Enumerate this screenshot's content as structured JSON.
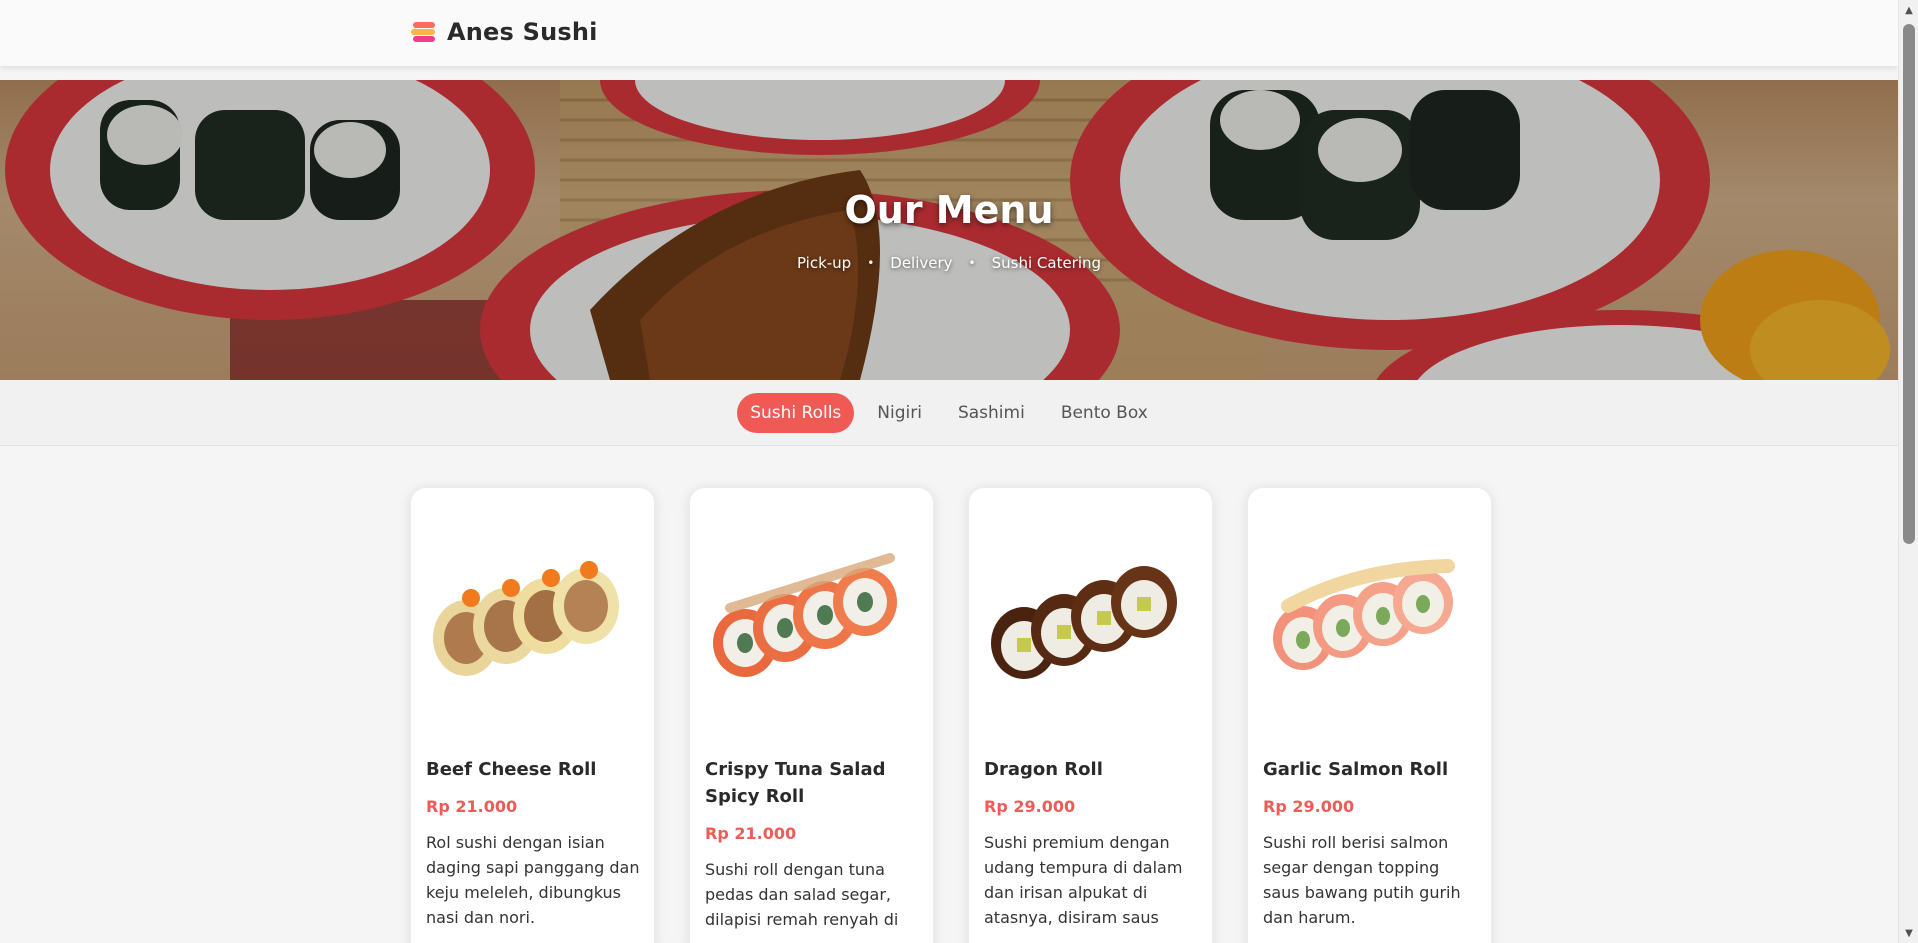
{
  "brand": {
    "name": "Anes Sushi",
    "logo_icon": "layered-sushi-icon"
  },
  "hero": {
    "title": "Our Menu",
    "links": [
      "Pick-up",
      "Delivery",
      "Sushi Catering"
    ],
    "separator": "•"
  },
  "tabs": [
    {
      "label": "Sushi Rolls",
      "active": true
    },
    {
      "label": "Nigiri",
      "active": false
    },
    {
      "label": "Sashimi",
      "active": false
    },
    {
      "label": "Bento Box",
      "active": false
    }
  ],
  "menu": [
    {
      "name": "Beef Cheese Roll",
      "price": "Rp 21.000",
      "description": "Rol sushi dengan isian daging sapi panggang dan keju meleleh, dibungkus nasi dan nori.",
      "image_icon": "beef-cheese-roll-image"
    },
    {
      "name": "Crispy Tuna Salad Spicy Roll",
      "price": "Rp 21.000",
      "description": "Sushi roll dengan tuna pedas dan salad segar, dilapisi remah renyah di",
      "image_icon": "crispy-tuna-roll-image"
    },
    {
      "name": "Dragon Roll",
      "price": "Rp 29.000",
      "description": "Sushi premium dengan udang tempura di dalam dan irisan alpukat di atasnya, disiram saus",
      "image_icon": "dragon-roll-image"
    },
    {
      "name": "Garlic Salmon Roll",
      "price": "Rp 29.000",
      "description": "Sushi roll berisi salmon segar dengan topping saus bawang putih gurih dan harum.",
      "image_icon": "garlic-salmon-roll-image"
    }
  ],
  "colors": {
    "accent": "#f05a55",
    "price": "#ee5c57",
    "header_bg": "#fafafa",
    "page_bg": "#f5f5f5"
  }
}
